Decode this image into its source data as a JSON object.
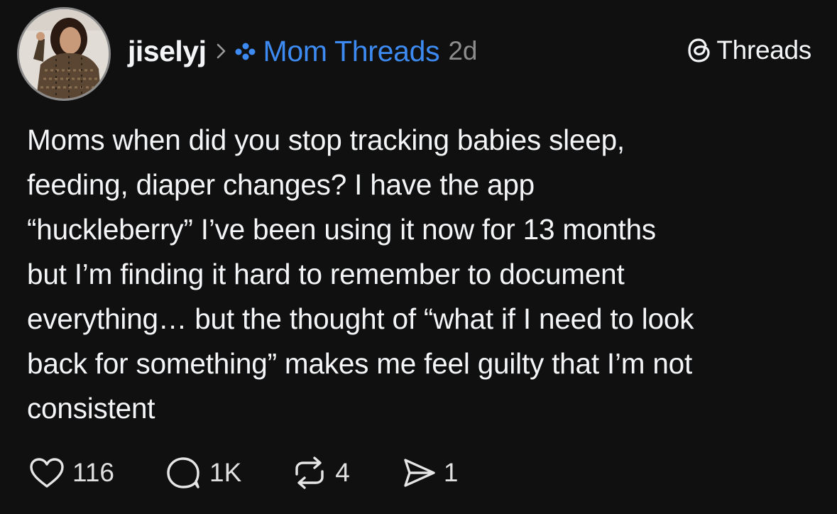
{
  "header": {
    "username": "jiselyj",
    "community": "Mom Threads",
    "age": "2d",
    "brand_label": "Threads"
  },
  "post": {
    "lines": [
      "Moms when did you stop tracking babies sleep,",
      "feeding, diaper changes? I have the app",
      "“huckleberry” I’ve been using it now for 13 months",
      "but I’m finding it hard to remember to document",
      "everything… but the thought of “what if I need to look",
      "back for something” makes me feel guilty that I’m not",
      "consistent"
    ]
  },
  "actions": {
    "likes": "116",
    "replies": "1K",
    "reposts": "4",
    "shares": "1"
  },
  "icons": {
    "avatar": "avatar-photo",
    "chevron": "chevron-right-icon",
    "community": "community-dots-icon",
    "brand": "threads-logo-icon",
    "like": "heart-icon",
    "reply": "comment-icon",
    "repost": "repost-icon",
    "share": "send-icon"
  },
  "colors": {
    "background": "#101010",
    "text": "#f3f5f7",
    "community_link": "#3d8bf2",
    "muted": "#8c8c8c"
  }
}
